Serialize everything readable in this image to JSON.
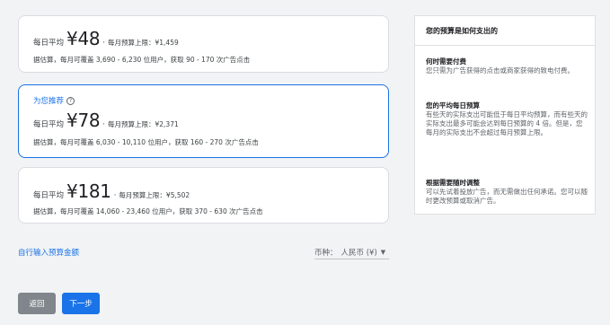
{
  "options": [
    {
      "avg_label": "每日平均",
      "price": "¥48",
      "separator": "·",
      "cap_text": "每月预算上限：¥1,459",
      "estimate": "据估算，每月可覆盖 3,690 - 6,230 位用户，获取 90 - 170 次广告点击"
    },
    {
      "recommended_label": "为您推荐",
      "help_icon": "?",
      "avg_label": "每日平均",
      "price": "¥78",
      "separator": "·",
      "cap_text": "每月预算上限：¥2,371",
      "estimate": "据估算，每月可覆盖 6,030 - 10,110 位用户，获取 160 - 270 次广告点击"
    },
    {
      "avg_label": "每日平均",
      "price": "¥181",
      "separator": "·",
      "cap_text": "每月预算上限：¥5,502",
      "estimate": "据估算，每月可覆盖 14,060 - 23,460 位用户，获取 370 - 630 次广告点击"
    }
  ],
  "selected_option": 1,
  "side_panel": {
    "title": "您的预算是如何支出的",
    "sections": [
      {
        "heading": "何时需要付费",
        "body": "您只需为广告获得的点击或商家获得的致电付费。"
      },
      {
        "heading": "您的平均每日预算",
        "body": "有些天的实际支出可能低于每日平均预算，而有些天的实际支出最多可能会达到每日预算的 4 倍。但是，您每月的实际支出不会超过每月预算上限。"
      },
      {
        "heading": "根据需要随时调整",
        "body": "可以先试着投放广告，而无需做出任何承诺。您可以随时更改预算或取消广告。"
      }
    ]
  },
  "custom_budget_link": "自行输入预算金额",
  "currency": {
    "label": "币种：",
    "value": "人民币 (¥)",
    "icon": "caret-down-icon"
  },
  "buttons": {
    "back": "返回",
    "next": "下一步"
  },
  "colors": {
    "accent": "#1a73e8",
    "back_button": "#80868b"
  }
}
